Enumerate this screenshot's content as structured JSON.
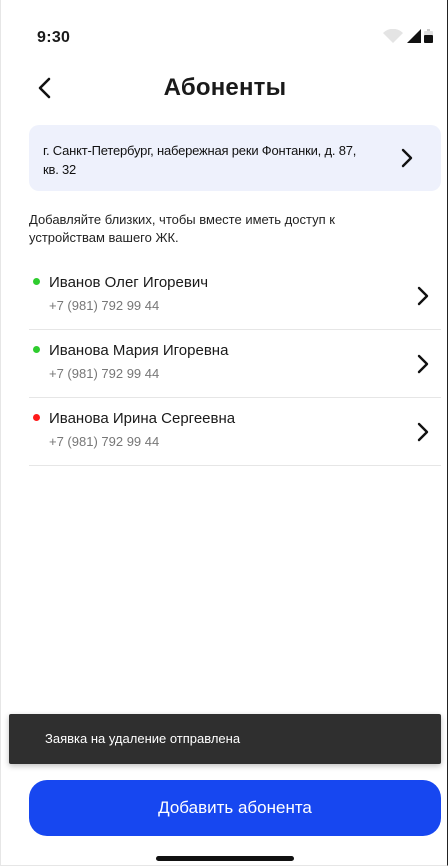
{
  "status_bar": {
    "time": "9:30",
    "icons": [
      "wifi-icon",
      "signal-icon",
      "battery-icon"
    ]
  },
  "header": {
    "back_icon": "chevron-left-icon",
    "title": "Абоненты"
  },
  "address": {
    "text": "г. Санкт-Петербург, набережная реки Фонтанки, д. 87, кв. 32",
    "icon": "chevron-right-icon"
  },
  "hint": "Добавляйте близких, чтобы вместе иметь доступ к устройствам вашего ЖК.",
  "subscribers": [
    {
      "name": "Иванов Олег Игоревич",
      "phone": "+7 (981) 792 99 44",
      "status_color": "#2ecc2e"
    },
    {
      "name": "Иванова Мария Игоревна",
      "phone": "+7 (981) 792 99 44",
      "status_color": "#2ecc2e"
    },
    {
      "name": "Иванова Ирина Сергеевна",
      "phone": "+7 (981) 792 99 44",
      "status_color": "#ff1a1a"
    }
  ],
  "toast": {
    "text": "Заявка на удаление отправлена"
  },
  "add_button": {
    "label": "Добавить абонента"
  },
  "colors": {
    "accent": "#1747f0",
    "card_background": "#eef1fc",
    "toast_background": "#2f2f2f"
  }
}
